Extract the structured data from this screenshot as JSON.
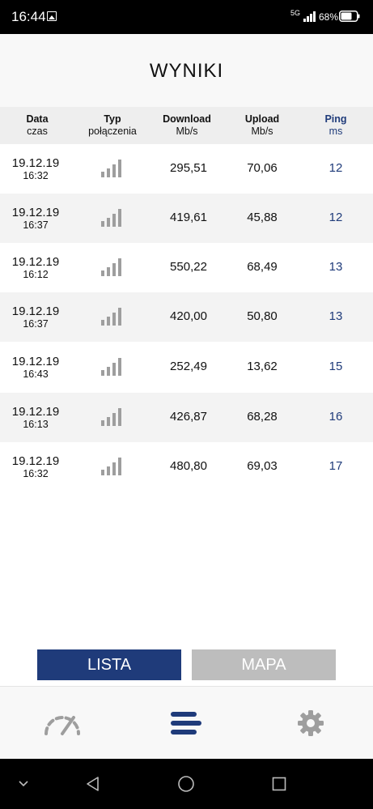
{
  "status_bar": {
    "time": "16:44",
    "network": "5G",
    "battery": "68%",
    "icons": [
      "image-icon",
      "signal-icon",
      "battery-icon"
    ]
  },
  "header": {
    "title": "WYNIKI"
  },
  "columns": [
    {
      "title": "Data",
      "sub": "czas"
    },
    {
      "title": "Typ",
      "sub": "połączenia"
    },
    {
      "title": "Download",
      "sub": "Mb/s"
    },
    {
      "title": "Upload",
      "sub": "Mb/s"
    },
    {
      "title": "Ping",
      "sub": "ms"
    }
  ],
  "results": [
    {
      "date": "19.12.19",
      "time": "16:32",
      "download": "295,51",
      "upload": "70,06",
      "ping": "12"
    },
    {
      "date": "19.12.19",
      "time": "16:37",
      "download": "419,61",
      "upload": "45,88",
      "ping": "12"
    },
    {
      "date": "19.12.19",
      "time": "16:12",
      "download": "550,22",
      "upload": "68,49",
      "ping": "13"
    },
    {
      "date": "19.12.19",
      "time": "16:37",
      "download": "420,00",
      "upload": "50,80",
      "ping": "13"
    },
    {
      "date": "19.12.19",
      "time": "16:43",
      "download": "252,49",
      "upload": "13,62",
      "ping": "15"
    },
    {
      "date": "19.12.19",
      "time": "16:13",
      "download": "426,87",
      "upload": "68,28",
      "ping": "16"
    },
    {
      "date": "19.12.19",
      "time": "16:32",
      "download": "480,80",
      "upload": "69,03",
      "ping": "17"
    }
  ],
  "segment": {
    "lista": "LISTA",
    "mapa": "MAPA",
    "selected": "LISTA"
  },
  "bottom_nav": [
    {
      "icon": "speedometer-icon",
      "active": false
    },
    {
      "icon": "list-icon",
      "active": true
    },
    {
      "icon": "gear-icon",
      "active": false
    }
  ],
  "system_nav": [
    "chevron-down-icon",
    "back-icon",
    "home-icon",
    "recents-icon"
  ],
  "colors": {
    "accent": "#1f3b7a",
    "inactive": "#bdbdbd",
    "signal": "#9e9e9e"
  }
}
